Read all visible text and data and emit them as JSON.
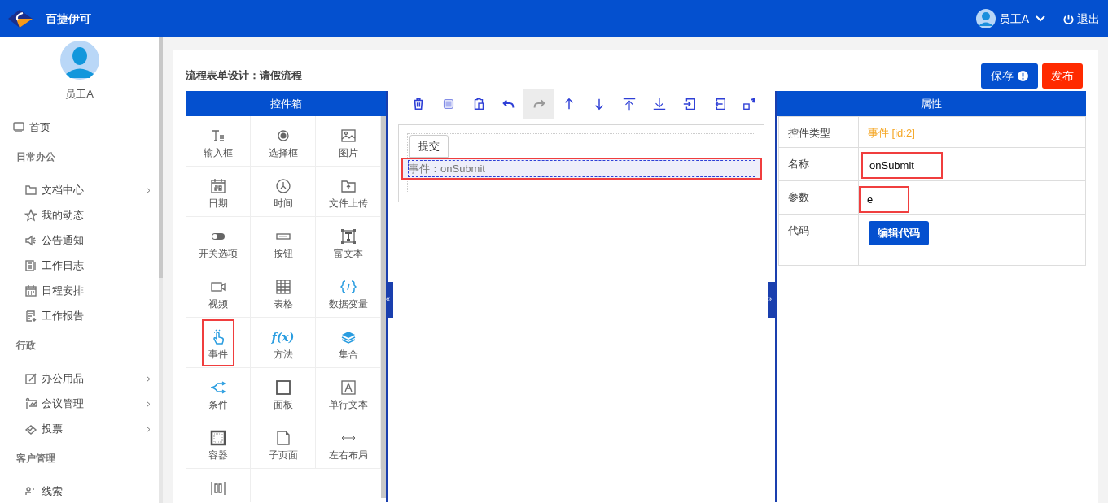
{
  "header": {
    "brand": "百捷伊可",
    "user": "员工A",
    "logout": "退出"
  },
  "sidebar": {
    "user": "员工A",
    "items": [
      {
        "kind": "link",
        "label": "首页",
        "expandable": false
      },
      {
        "kind": "section",
        "label": "日常办公"
      },
      {
        "kind": "sub",
        "label": "文档中心",
        "expandable": true
      },
      {
        "kind": "sub",
        "label": "我的动态",
        "expandable": false
      },
      {
        "kind": "sub",
        "label": "公告通知",
        "expandable": false
      },
      {
        "kind": "sub",
        "label": "工作日志",
        "expandable": false
      },
      {
        "kind": "sub",
        "label": "日程安排",
        "expandable": false
      },
      {
        "kind": "sub",
        "label": "工作报告",
        "expandable": false
      },
      {
        "kind": "section",
        "label": "行政"
      },
      {
        "kind": "sub",
        "label": "办公用品",
        "expandable": true
      },
      {
        "kind": "sub",
        "label": "会议管理",
        "expandable": true
      },
      {
        "kind": "sub",
        "label": "投票",
        "expandable": true
      },
      {
        "kind": "section",
        "label": "客户管理"
      },
      {
        "kind": "sub",
        "label": "线索",
        "expandable": false
      }
    ]
  },
  "page": {
    "title": "流程表单设计：请假流程",
    "save": "保存",
    "publish": "发布"
  },
  "toolbox": {
    "title": "控件箱",
    "function_icon_text": "f(x)",
    "items": [
      {
        "label": "输入框",
        "highlighted": false
      },
      {
        "label": "选择框",
        "highlighted": false
      },
      {
        "label": "图片",
        "highlighted": false
      },
      {
        "label": "日期",
        "highlighted": false
      },
      {
        "label": "时间",
        "highlighted": false
      },
      {
        "label": "文件上传",
        "highlighted": false
      },
      {
        "label": "开关选项",
        "highlighted": false
      },
      {
        "label": "按钮",
        "highlighted": false
      },
      {
        "label": "富文本",
        "highlighted": false
      },
      {
        "label": "视频",
        "highlighted": false
      },
      {
        "label": "表格",
        "highlighted": false
      },
      {
        "label": "数据变量",
        "highlighted": false
      },
      {
        "label": "事件",
        "highlighted": true
      },
      {
        "label": "方法",
        "highlighted": false
      },
      {
        "label": "集合",
        "highlighted": false
      },
      {
        "label": "条件",
        "highlighted": false
      },
      {
        "label": "面板",
        "highlighted": false
      },
      {
        "label": "单行文本",
        "highlighted": false
      },
      {
        "label": "容器",
        "highlighted": false
      },
      {
        "label": "子页面",
        "highlighted": false
      },
      {
        "label": "左右布局",
        "highlighted": false
      },
      {
        "highlighted": false
      }
    ]
  },
  "toolbar": [
    {
      "disabled": false
    },
    {
      "disabled": false
    },
    {
      "disabled": false
    },
    {
      "disabled": false
    },
    {
      "disabled": true
    },
    {
      "disabled": false
    },
    {
      "disabled": false
    },
    {
      "disabled": false
    },
    {
      "disabled": false
    },
    {
      "disabled": false
    },
    {
      "disabled": false
    },
    {
      "disabled": false
    }
  ],
  "handles": [
    "«",
    "»"
  ],
  "canvas": {
    "button": "提交",
    "event": "事件：onSubmit",
    "event_selected": true
  },
  "properties": {
    "title": "属性",
    "rows": [
      {
        "kind": "type",
        "label": "控件类型",
        "value": "事件 [id:2]",
        "highlighted": false
      },
      {
        "kind": "input",
        "label": "名称",
        "value": "onSubmit",
        "highlighted": true
      },
      {
        "kind": "input",
        "label": "参数",
        "value": "e",
        "highlighted": true
      },
      {
        "kind": "button",
        "label": "代码",
        "value": "编辑代码",
        "highlighted": false
      }
    ]
  }
}
